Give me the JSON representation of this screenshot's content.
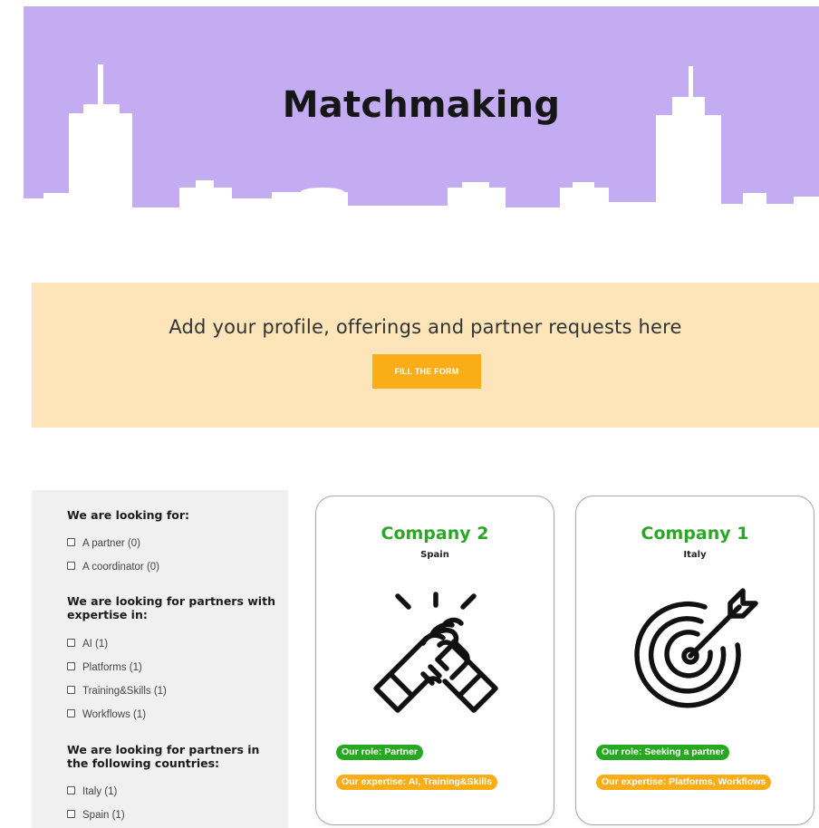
{
  "hero": {
    "title": "Matchmaking",
    "background_color": "#c4acf2",
    "skyline_color": "#ffffff"
  },
  "cta": {
    "text": "Add your profile, offerings and partner requests here",
    "button_label": "FILL THE FORM",
    "background_color": "#fde5b9",
    "button_color": "#fbad18"
  },
  "filters": {
    "groups": [
      {
        "heading": "We are looking for:",
        "options": [
          {
            "label": "A partner (0)",
            "checked": false
          },
          {
            "label": "A coordinator (0)",
            "checked": false
          }
        ]
      },
      {
        "heading": "We are looking for partners with expertise in:",
        "options": [
          {
            "label": "AI (1)",
            "checked": false
          },
          {
            "label": "Platforms (1)",
            "checked": false
          },
          {
            "label": "Training&Skills (1)",
            "checked": false
          },
          {
            "label": "Workflows (1)",
            "checked": false
          }
        ]
      },
      {
        "heading": "We are looking for partners in the following countries:",
        "options": [
          {
            "label": "Italy (1)",
            "checked": false
          },
          {
            "label": "Spain (1)",
            "checked": false
          }
        ]
      }
    ]
  },
  "cards": [
    {
      "name": "Company 2",
      "country": "Spain",
      "icon": "handshake-icon",
      "role": "Our role: Partner",
      "expertise": "Our expertise: AI, Training&Skills"
    },
    {
      "name": "Company 1",
      "country": "Italy",
      "icon": "target-arrow-icon",
      "role": "Our role: Seeking a partner",
      "expertise": "Our expertise: Platforms, Workflows"
    }
  ],
  "colors": {
    "accent_green": "#27a821",
    "accent_orange": "#fbad18",
    "title_green": "#2aa824"
  }
}
